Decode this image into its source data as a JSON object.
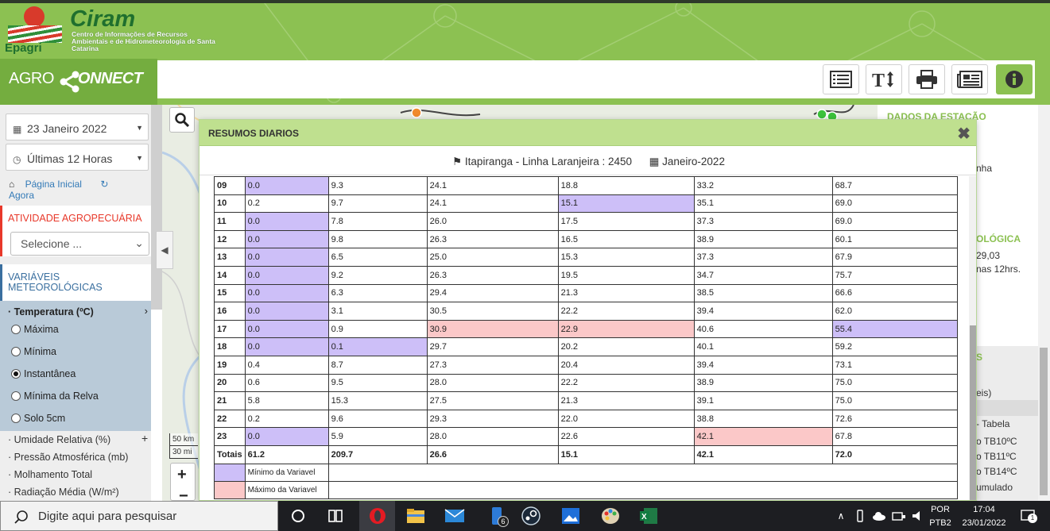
{
  "brand": {
    "name": "Ciram",
    "org": "Epagri",
    "subtitle": "Centro de Informações de Recursos Ambientais e de Hidrometeorologia de Santa Catarina",
    "app_prefix": "AGRO",
    "app_suffix": "ONNECT"
  },
  "colors": {
    "accent_green": "#8cc152",
    "header_green": "#74ad3f",
    "alert_red": "#e8382a",
    "min_color": "#cdbff8",
    "max_color": "#fbc8c8"
  },
  "toolbar": {
    "buttons": [
      "list-icon",
      "text-size-icon",
      "print-icon",
      "newspaper-icon",
      "info-icon"
    ]
  },
  "sidebar": {
    "date": "23 Janeiro 2022",
    "period": "Últimas 12 Horas",
    "home_link": "Página Inicial",
    "now_link": "Agora",
    "agri_title": "ATIVIDADE AGROPECUÁRIA",
    "agri_select": "Selecione ...",
    "vars_title": "VARIÁVEIS METEOROLÓGICAS",
    "temp_title": "· Temperatura (ºC)",
    "temp_options": [
      "Máxima",
      "Mínima",
      "Instantânea",
      "Mínima da Relva",
      "Solo 5cm"
    ],
    "other_vars": [
      "· Umidade Relativa (%)",
      "· Pressão Atmosférica (mb)",
      "· Molhamento Total",
      "· Radiação Média (W/m²)"
    ]
  },
  "map": {
    "scale_km": "50 km",
    "scale_mi": "30 mi",
    "zoom_in": "+",
    "zoom_out": "−"
  },
  "right_panel": {
    "title1": "DADOS DA ESTAÇÃO",
    "frag1": "nha",
    "title2": "OLÓGICA",
    "frag2": "29,03",
    "frag3": "nas 12hrs.",
    "frag4": "S",
    "frag5": "eis)",
    "frag6": "- Tabela",
    "frag7": "o TB10ºC",
    "frag8": "o TB11ºC",
    "frag9": "o TB14ºC",
    "frag10": "umulado"
  },
  "modal": {
    "title": "RESUMOS DIARIOS",
    "station": "Itapiranga - Linha Laranjeira : 2450",
    "month": "Janeiro-2022",
    "rows": [
      {
        "day": "09",
        "v": [
          "0.0",
          "9.3",
          "24.1",
          "18.8",
          "33.2",
          "68.7"
        ],
        "hl": [
          "min",
          "",
          "",
          "",
          "",
          ""
        ]
      },
      {
        "day": "10",
        "v": [
          "0.2",
          "9.7",
          "24.1",
          "15.1",
          "35.1",
          "69.0"
        ],
        "hl": [
          "",
          "",
          "",
          "min",
          "",
          ""
        ]
      },
      {
        "day": "11",
        "v": [
          "0.0",
          "7.8",
          "26.0",
          "17.5",
          "37.3",
          "69.0"
        ],
        "hl": [
          "min",
          "",
          "",
          "",
          "",
          ""
        ]
      },
      {
        "day": "12",
        "v": [
          "0.0",
          "9.8",
          "26.3",
          "16.5",
          "38.9",
          "60.1"
        ],
        "hl": [
          "min",
          "",
          "",
          "",
          "",
          ""
        ]
      },
      {
        "day": "13",
        "v": [
          "0.0",
          "6.5",
          "25.0",
          "15.3",
          "37.3",
          "67.9"
        ],
        "hl": [
          "min",
          "",
          "",
          "",
          "",
          ""
        ]
      },
      {
        "day": "14",
        "v": [
          "0.0",
          "9.2",
          "26.3",
          "19.5",
          "34.7",
          "75.7"
        ],
        "hl": [
          "min",
          "",
          "",
          "",
          "",
          ""
        ]
      },
      {
        "day": "15",
        "v": [
          "0.0",
          "6.3",
          "29.4",
          "21.3",
          "38.5",
          "66.6"
        ],
        "hl": [
          "min",
          "",
          "",
          "",
          "",
          ""
        ]
      },
      {
        "day": "16",
        "v": [
          "0.0",
          "3.1",
          "30.5",
          "22.2",
          "39.4",
          "62.0"
        ],
        "hl": [
          "min",
          "",
          "",
          "",
          "",
          ""
        ]
      },
      {
        "day": "17",
        "v": [
          "0.0",
          "0.9",
          "30.9",
          "22.9",
          "40.6",
          "55.4"
        ],
        "hl": [
          "min",
          "",
          "max",
          "max",
          "",
          "min"
        ]
      },
      {
        "day": "18",
        "v": [
          "0.0",
          "0.1",
          "29.7",
          "20.2",
          "40.1",
          "59.2"
        ],
        "hl": [
          "min",
          "min",
          "",
          "",
          "",
          ""
        ]
      },
      {
        "day": "19",
        "v": [
          "0.4",
          "8.7",
          "27.3",
          "20.4",
          "39.4",
          "73.1"
        ],
        "hl": [
          "",
          "",
          "",
          "",
          "",
          ""
        ]
      },
      {
        "day": "20",
        "v": [
          "0.6",
          "9.5",
          "28.0",
          "22.2",
          "38.9",
          "75.0"
        ],
        "hl": [
          "",
          "",
          "",
          "",
          "",
          ""
        ]
      },
      {
        "day": "21",
        "v": [
          "5.8",
          "15.3",
          "27.5",
          "21.3",
          "39.1",
          "75.0"
        ],
        "hl": [
          "",
          "",
          "",
          "",
          "",
          ""
        ]
      },
      {
        "day": "22",
        "v": [
          "0.2",
          "9.6",
          "29.3",
          "22.0",
          "38.8",
          "72.6"
        ],
        "hl": [
          "",
          "",
          "",
          "",
          "",
          ""
        ]
      },
      {
        "day": "23",
        "v": [
          "0.0",
          "5.9",
          "28.0",
          "22.6",
          "42.1",
          "67.8"
        ],
        "hl": [
          "min",
          "",
          "",
          "",
          "max",
          ""
        ]
      }
    ],
    "totals_label": "Totais",
    "totals": [
      "61.2",
      "209.7",
      "26.6",
      "15.1",
      "42.1",
      "72.0"
    ],
    "legend_min": "Mínimo da Variavel",
    "legend_max": "Máximo da Variavel"
  },
  "taskbar": {
    "search_placeholder": "Digite aqui para pesquisar",
    "lang": "POR",
    "layout": "PTB2",
    "time": "17:04",
    "date": "23/01/2022",
    "badge_files": "6",
    "notif": "1"
  }
}
